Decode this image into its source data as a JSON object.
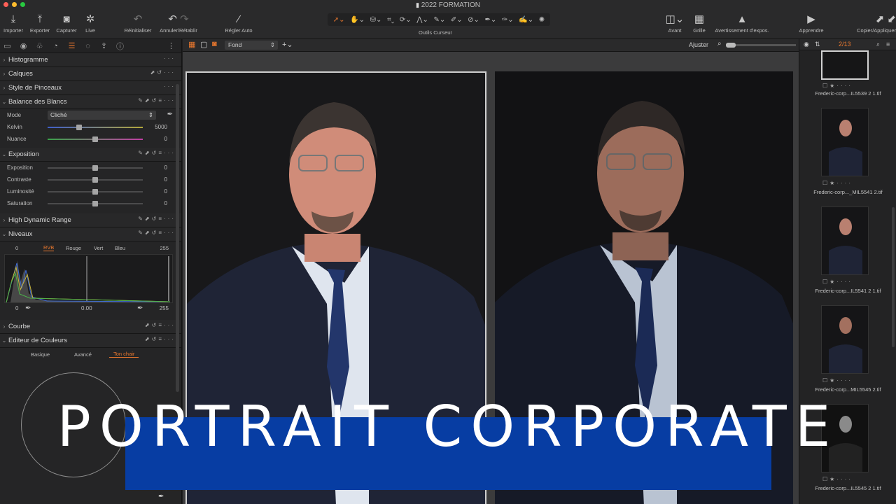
{
  "window": {
    "title": "2022 FORMATION"
  },
  "toolbar": {
    "items": [
      {
        "label": "Importer",
        "icon": "import-icon"
      },
      {
        "label": "Exporter",
        "icon": "export-icon"
      },
      {
        "label": "Capturer",
        "icon": "camera-icon"
      },
      {
        "label": "Live",
        "icon": "live-icon"
      },
      {
        "label": "Réinitialiser",
        "icon": "reset-icon"
      },
      {
        "label": "Annuler/Rétablir",
        "icon": "undo-redo-icon"
      },
      {
        "label": "Régler Auto",
        "icon": "magic-wand-icon"
      },
      {
        "label": "Avant",
        "icon": "before-after-icon"
      },
      {
        "label": "Grille",
        "icon": "grid-icon"
      },
      {
        "label": "Avertissement d'expos.",
        "icon": "warning-icon"
      },
      {
        "label": "Apprendre",
        "icon": "play-icon"
      },
      {
        "label": "Copier/Appliquer",
        "icon": "copy-apply-icon"
      }
    ],
    "cursor_tools_label": "Outils Curseur"
  },
  "left_panel": {
    "sections": {
      "histogramme": "Histogramme",
      "calques": "Calques",
      "style": "Style de Pinceaux",
      "balance": "Balance des Blancs",
      "exposition": "Exposition",
      "hdr": "High Dynamic Range",
      "niveaux": "Niveaux",
      "courbe": "Courbe",
      "couleurs": "Editeur de Couleurs"
    },
    "white_balance": {
      "mode_label": "Mode",
      "mode_value": "Cliché",
      "kelvin_label": "Kelvin",
      "kelvin_value": "5000",
      "kelvin_level": 0.33,
      "nuance_label": "Nuance",
      "nuance_value": "0",
      "nuance_level": 0.5
    },
    "exposure": [
      {
        "label": "Exposition",
        "value": "0",
        "level": 0.5
      },
      {
        "label": "Contraste",
        "value": "0",
        "level": 0.5
      },
      {
        "label": "Luminosité",
        "value": "0",
        "level": 0.5
      },
      {
        "label": "Saturation",
        "value": "0",
        "level": 0.5
      }
    ],
    "levels": {
      "low": "0",
      "high": "255",
      "tabs": [
        "RVB",
        "Rouge",
        "Vert",
        "Bleu"
      ],
      "active_tab": "RVB",
      "bottom_low": "0",
      "bottom_mid": "0.00",
      "bottom_high": "255"
    },
    "color_editor_tabs": [
      "Basique",
      "Avancé",
      "Ton chair"
    ],
    "color_editor_active": "Ton chair"
  },
  "viewer": {
    "bg_label": "Fond",
    "adjust_label": "Ajuster"
  },
  "browser": {
    "counter": "2/13",
    "thumbnails": [
      {
        "name": "Frederic-corp...IL5539 2 1.tif"
      },
      {
        "name": "Frederic-corp..._MIL5541 2.tif"
      },
      {
        "name": "Frederic-corp...IL5541 2 1.tif"
      },
      {
        "name": "Frederic-corp...MIL5545 2.tif"
      },
      {
        "name": "Frederic-corp...IL5545 2 1.tif"
      }
    ]
  },
  "overlay": {
    "title": "PORTRAIT CORPORATE",
    "banner_color": "#073da3"
  },
  "colors": {
    "accent": "#e8772e"
  }
}
